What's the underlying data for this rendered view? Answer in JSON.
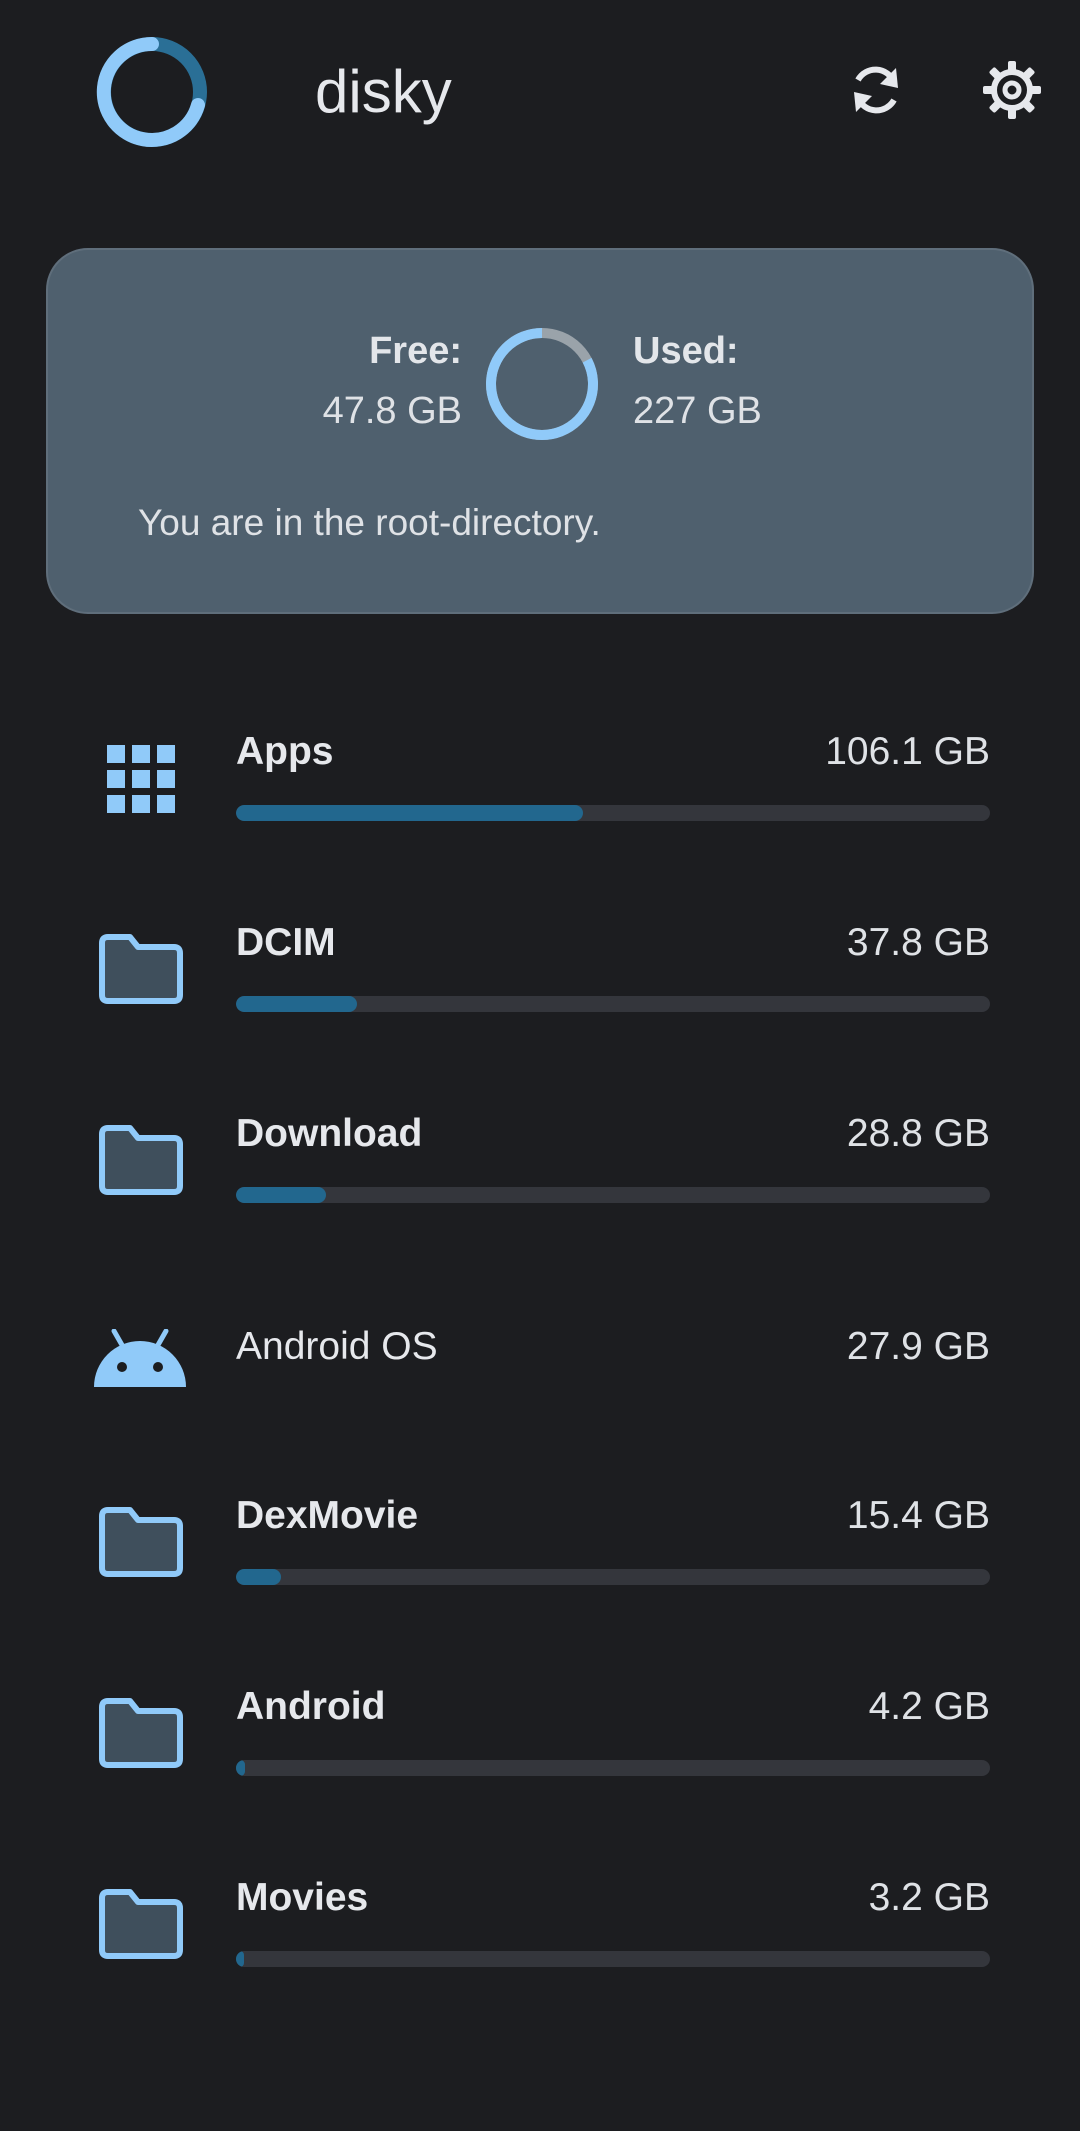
{
  "app": {
    "title": "disky"
  },
  "accent": "#90caf9",
  "summary": {
    "free_label": "Free:",
    "free_value": "47.8 GB",
    "used_label": "Used:",
    "used_value": "227 GB",
    "used_fraction": 0.826,
    "message": "You are in the root-directory."
  },
  "items": [
    {
      "name": "Apps",
      "size": "106.1 GB",
      "fraction": 0.46,
      "icon": "apps-grid-icon",
      "bold": true,
      "bar": true
    },
    {
      "name": "DCIM",
      "size": "37.8 GB",
      "fraction": 0.16,
      "icon": "folder-icon",
      "bold": true,
      "bar": true
    },
    {
      "name": "Download",
      "size": "28.8 GB",
      "fraction": 0.12,
      "icon": "folder-icon",
      "bold": true,
      "bar": true
    },
    {
      "name": "Android OS",
      "size": "27.9 GB",
      "fraction": 0.0,
      "icon": "android-icon",
      "bold": false,
      "bar": false
    },
    {
      "name": "DexMovie",
      "size": "15.4 GB",
      "fraction": 0.06,
      "icon": "folder-icon",
      "bold": true,
      "bar": true
    },
    {
      "name": "Android",
      "size": "4.2 GB",
      "fraction": 0.012,
      "icon": "folder-icon",
      "bold": true,
      "bar": true
    },
    {
      "name": "Movies",
      "size": "3.2 GB",
      "fraction": 0.01,
      "icon": "folder-icon",
      "bold": true,
      "bar": true
    }
  ]
}
